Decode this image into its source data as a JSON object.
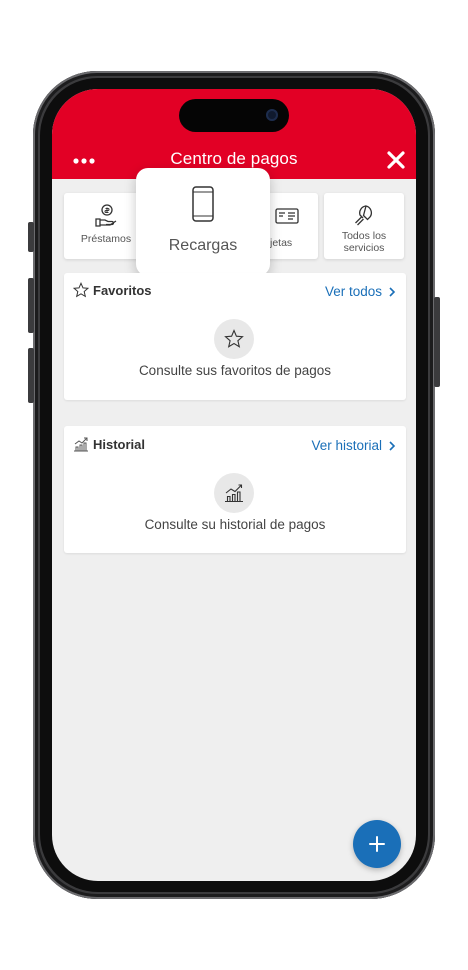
{
  "header": {
    "title": "Centro de pagos",
    "more_icon": "more-dots-icon",
    "close_icon": "close-icon",
    "color": "#e20025"
  },
  "quick_actions": [
    {
      "label": "Préstamos",
      "icon": "loan-hand-coin-icon"
    },
    {
      "label": "Recargas",
      "icon": "phone-icon"
    },
    {
      "label": "jetas",
      "icon": "card-id-icon"
    },
    {
      "label": "Todos los servicios",
      "icon": "lightbulb-icon"
    }
  ],
  "popup": {
    "label": "Recargas",
    "icon": "phone-icon"
  },
  "favorites": {
    "title": "Favoritos",
    "icon": "star-icon",
    "link": "Ver todos",
    "empty_text": "Consulte sus favoritos de pagos"
  },
  "history": {
    "title": "Historial",
    "icon": "chart-icon",
    "link": "Ver historial",
    "empty_text": "Consulte su historial de pagos"
  },
  "fab": {
    "icon": "plus-icon",
    "color": "#1a6fb8"
  },
  "colors": {
    "brand_red": "#e20025",
    "link_blue": "#1a6fb8",
    "background": "#efefef"
  }
}
